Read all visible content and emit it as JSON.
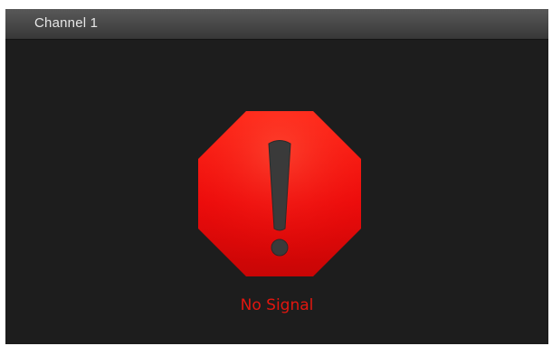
{
  "window": {
    "title": "Channel 1"
  },
  "status": {
    "message": "No Signal",
    "icon": "stop-sign-exclamation-icon",
    "color": "#e3160f"
  }
}
